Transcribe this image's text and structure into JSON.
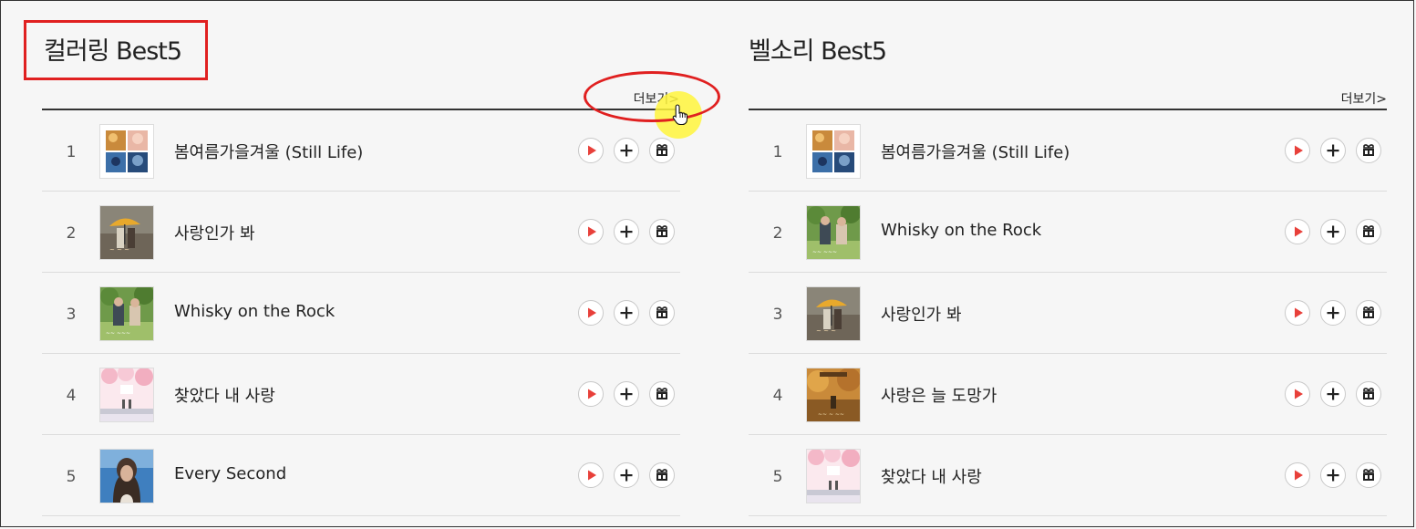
{
  "left": {
    "title": "컬러링 Best5",
    "more_label": "더보기>",
    "songs": [
      {
        "rank": "1",
        "title": "봄여름가을겨울 (Still Life)",
        "art": "collage"
      },
      {
        "rank": "2",
        "title": "사랑인가 봐",
        "art": "umbrella"
      },
      {
        "rank": "3",
        "title": "Whisky on the Rock",
        "art": "green"
      },
      {
        "rank": "4",
        "title": "찾았다 내 사랑",
        "art": "pink"
      },
      {
        "rank": "5",
        "title": "Every Second",
        "art": "portrait"
      }
    ]
  },
  "right": {
    "title": "벨소리 Best5",
    "more_label": "더보기>",
    "songs": [
      {
        "rank": "1",
        "title": "봄여름가을겨울 (Still Life)",
        "art": "collage"
      },
      {
        "rank": "2",
        "title": "Whisky on the Rock",
        "art": "green"
      },
      {
        "rank": "3",
        "title": "사랑인가 봐",
        "art": "umbrella"
      },
      {
        "rank": "4",
        "title": "사랑은 늘 도망가",
        "art": "autumn"
      },
      {
        "rank": "5",
        "title": "찾았다 내 사랑",
        "art": "pink"
      }
    ]
  },
  "icons": {
    "play": "play-icon",
    "add": "plus-icon",
    "gift": "gift-icon"
  },
  "colors": {
    "play": "#e8403a",
    "annotation": "#e02020",
    "cursor_highlight": "#fff53c"
  }
}
